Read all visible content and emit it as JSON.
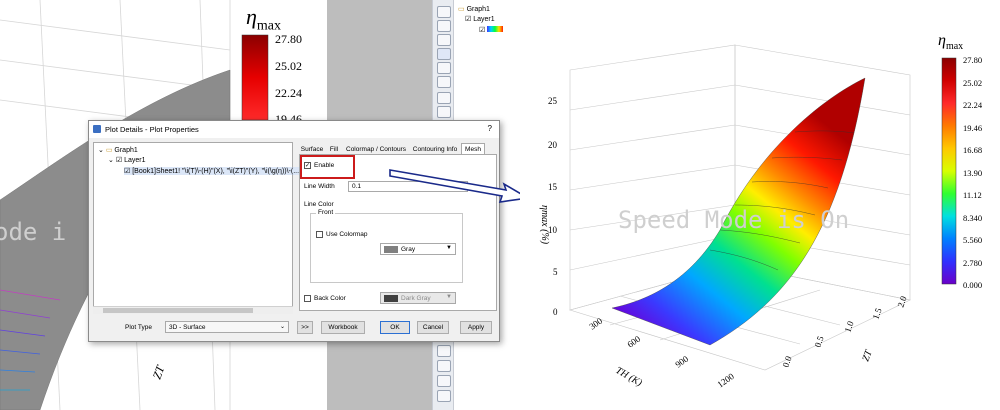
{
  "left_graph": {
    "colorbar_title_main": "η",
    "colorbar_title_sub": "max",
    "colorbar_ticks": [
      "27.80",
      "25.02",
      "22.24",
      "19.46"
    ],
    "watermark": "ode i",
    "axis_label": "ZT"
  },
  "object_manager": {
    "graph": "Graph1",
    "layer": "Layer1"
  },
  "dialog": {
    "title": "Plot Details - Plot Properties",
    "help": "?",
    "tree": {
      "root": "Graph1",
      "layer": "Layer1",
      "plot": "[Book1]Sheet1! \"\\i(T)\\-(H)\"(X), \"\\i(ZT)\"(Y), \"\\i(\\g(η))\\-(..."
    },
    "tabs": [
      "Surface",
      "Fill",
      "Colormap / Contours",
      "Contouring Info",
      "Mesh"
    ],
    "active_tab": "Mesh",
    "mesh": {
      "enable_label": "Enable",
      "enable_checked": true,
      "line_width_label": "Line Width",
      "line_width_value": "0.1",
      "line_color_label": "Line Color",
      "front_label": "Front",
      "use_colormap_label": "Use Colormap",
      "use_colormap_checked": false,
      "front_color_name": "Gray",
      "front_color_hex": "#808080",
      "back_color_label": "Back Color",
      "back_color_checked": false,
      "back_color_name": "Dark Gray",
      "back_color_hex": "#404040"
    },
    "plot_type_label": "Plot Type",
    "plot_type_value": "3D - Surface",
    "buttons": {
      "expand": ">>",
      "workbook": "Workbook",
      "ok": "OK",
      "cancel": "Cancel",
      "apply": "Apply"
    },
    "highlight_color": "#cc1b1b"
  },
  "arrow_color": "#1a2a8a",
  "right_chart": {
    "watermark": "Speed Mode is On",
    "z_axis_label": "ηmax (%)",
    "z_ticks": [
      "25",
      "20",
      "15",
      "10",
      "5",
      "0"
    ],
    "x_axis_label": "TH (K)",
    "x_ticks": [
      "300",
      "600",
      "900",
      "1200"
    ],
    "y_axis_label": "ZT",
    "y_ticks": [
      "0.0",
      "0.5",
      "1.0",
      "1.5",
      "2.0"
    ],
    "colorbar_title_main": "η",
    "colorbar_title_sub": "max",
    "colorbar_ticks": [
      "27.80",
      "25.02",
      "22.24",
      "19.46",
      "16.68",
      "13.90",
      "11.12",
      "8.340",
      "5.560",
      "2.780",
      "0.000"
    ]
  }
}
